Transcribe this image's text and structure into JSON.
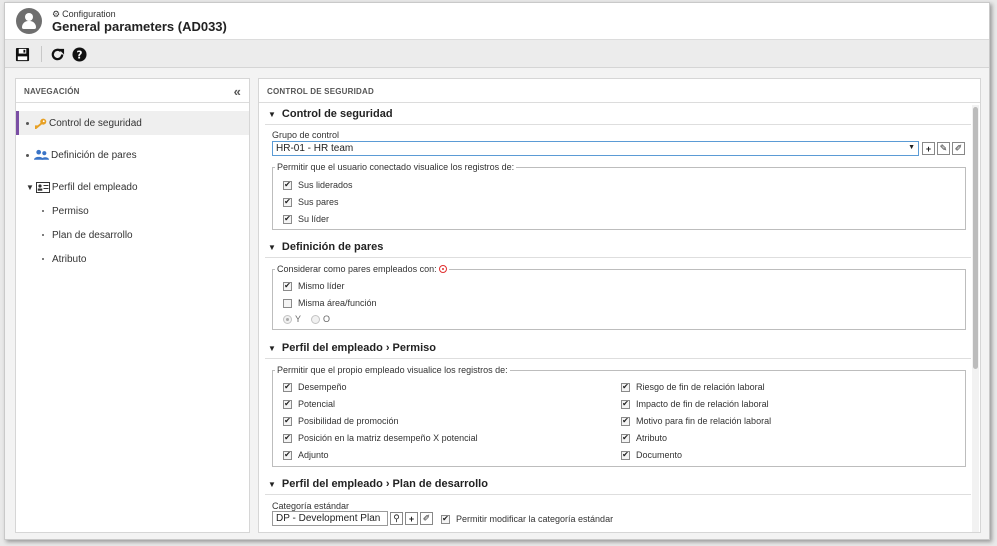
{
  "header": {
    "breadcrumb": "Configuration",
    "title": "General parameters (AD033)"
  },
  "toolbar": {
    "save": "save-icon",
    "refresh": "refresh-icon",
    "help": "help-icon"
  },
  "nav": {
    "title": "NAVEGACIÓN",
    "items": [
      {
        "label": "Control de seguridad"
      },
      {
        "label": "Definición de pares"
      },
      {
        "label": "Perfil del empleado"
      },
      {
        "label": "Permiso"
      },
      {
        "label": "Plan de desarrollo"
      },
      {
        "label": "Atributo"
      }
    ]
  },
  "main": {
    "title": "CONTROL DE SEGURIDAD",
    "control": {
      "title": "Control de seguridad",
      "group_label": "Grupo de control",
      "group_value": "HR-01 - HR team",
      "legend": "Permitir que el usuario conectado visualice los registros de:",
      "checks": [
        "Sus liderados",
        "Sus pares",
        "Su líder"
      ]
    },
    "pares": {
      "title": "Definición de pares",
      "legend": "Considerar como pares empleados con:",
      "checks": [
        {
          "label": "Mismo líder",
          "checked": true
        },
        {
          "label": "Misma área/función",
          "checked": false
        }
      ],
      "radio_and": "Y",
      "radio_or": "O"
    },
    "permiso": {
      "title": "Perfil del empleado › Permiso",
      "legend": "Permitir que el propio empleado visualice los registros de:",
      "left": [
        "Desempeño",
        "Potencial",
        "Posibilidad de promoción",
        "Posición en la matriz desempeño X potencial",
        "Adjunto"
      ],
      "right": [
        "Riesgo de fin de relación laboral",
        "Impacto de fin de relación laboral",
        "Motivo para fin de relación laboral",
        "Atributo",
        "Documento"
      ]
    },
    "plan": {
      "title": "Perfil del empleado › Plan de desarrollo",
      "category_label": "Categoría estándar",
      "category_value": "DP - Development Plan",
      "allow_modify": "Permitir modificar la categoría estándar"
    }
  }
}
